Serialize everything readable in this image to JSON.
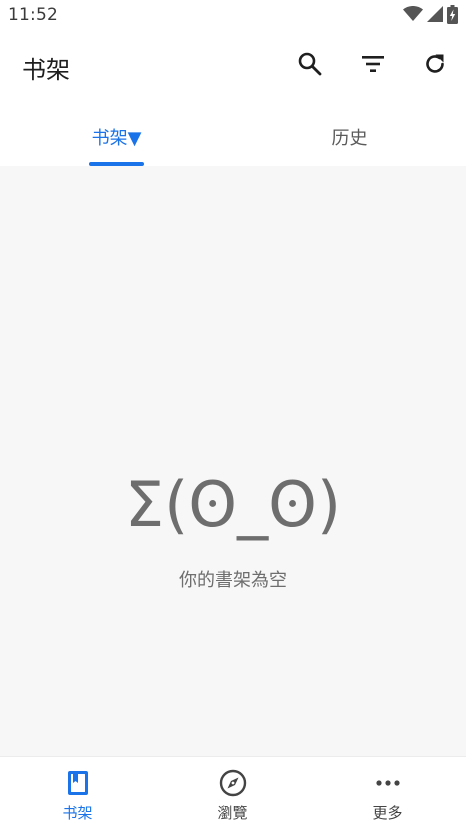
{
  "status_bar": {
    "time": "11:52",
    "icons": [
      "wifi-icon",
      "cell-signal-icon",
      "battery-charging-icon"
    ]
  },
  "app_bar": {
    "title": "书架",
    "actions": [
      "search-icon",
      "filter-icon",
      "refresh-icon"
    ]
  },
  "tabs": [
    {
      "label": "书架▼",
      "active": true
    },
    {
      "label": "历史",
      "active": false
    }
  ],
  "empty_state": {
    "emoticon": "Σ(ʘ_ʘ)",
    "message": "你的書架為空"
  },
  "bottom_nav": [
    {
      "label": "书架",
      "icon": "book-icon",
      "active": true
    },
    {
      "label": "瀏覽",
      "icon": "compass-icon",
      "active": false
    },
    {
      "label": "更多",
      "icon": "more-horizontal-icon",
      "active": false
    }
  ],
  "colors": {
    "accent": "#1a73e8",
    "content_background": "#f7f7f7",
    "empty_text": "#6e6e6e"
  }
}
